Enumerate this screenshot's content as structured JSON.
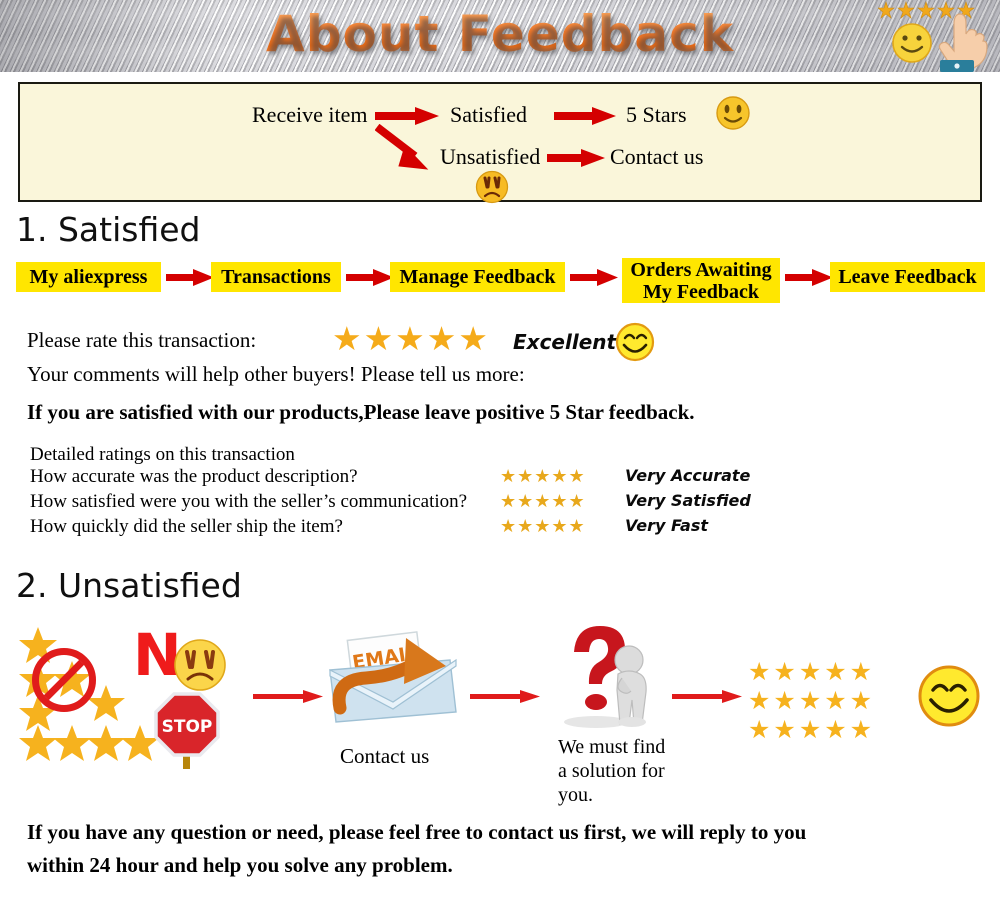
{
  "banner": {
    "title": "About Feedback",
    "badge_icon": "five-stars-smiley-hand-click-icon",
    "stars": "★★★★★",
    "accent_color": "#f4803a",
    "background_color": "#c9c9cd"
  },
  "flow_box": {
    "background_color": "#faf6da",
    "border_color": "#1a1a12",
    "nodes": {
      "start": "Receive item",
      "satisfied": "Satisfied",
      "five_stars": "5 Stars",
      "unsatisfied": "Unsatisfied",
      "contact_us": "Contact us"
    },
    "icons": {
      "happy": "happy-face-icon",
      "sad": "sad-face-icon",
      "arrow_right": "arrow-right-icon",
      "arrow_down_right": "arrow-down-right-icon"
    }
  },
  "section_satisfied": {
    "heading": "1. Satisfied",
    "steps": [
      "My aliexpress",
      "Transactions",
      "Manage Feedback",
      "Orders Awaiting\nMy Feedback",
      "Leave Feedback"
    ],
    "step_bg_color": "#ffe600",
    "arrow_color": "#d40000",
    "rate_prompt": "Please rate this transaction:",
    "rate_stars": "★★★★★",
    "rate_label": "Excellent",
    "rate_smiley": "grinning-smiley-icon",
    "comments_line": "Your comments will help other buyers! Please tell us more:",
    "bold_line": "If you are satisfied with our products,Please leave positive 5 Star feedback.",
    "detailed_heading": "Detailed ratings on this transaction",
    "detailed_rows": [
      {
        "question": "How accurate was the product description?",
        "stars": "★★★★★",
        "label": "Very Accurate"
      },
      {
        "question": "How satisfied were you with the seller’s communication?",
        "stars": "★★★★★",
        "label": "Very Satisfied"
      },
      {
        "question": "How quickly did the seller ship the item?",
        "stars": "★★★★★",
        "label": "Very Fast"
      }
    ]
  },
  "section_unsatisfied": {
    "heading": "2. Unsatisfied",
    "no_letter": "N",
    "stop_sign_text": "STOP",
    "email_badge_text": "EMAIL",
    "contact_caption": "Contact us",
    "solution_caption": "We must find\na solution for\nyou.",
    "icons": {
      "no-rating": "stars-prohibited-icon",
      "sad_face": "sad-face-icon",
      "stop_sign": "stop-sign-icon",
      "email": "email-envelope-icon",
      "question_person": "question-mark-person-icon",
      "arrow_right": "arrow-right-icon",
      "smiley": "grinning-smiley-icon",
      "star_grid": "fifteen-stars-grid-icon"
    },
    "star_grid_rows": 3,
    "star_grid_cols": 5
  },
  "footer": {
    "line1": "If you have any question or need, please feel free to contact us first, we will reply to you",
    "line2": "within 24 hour and help you solve any problem."
  }
}
